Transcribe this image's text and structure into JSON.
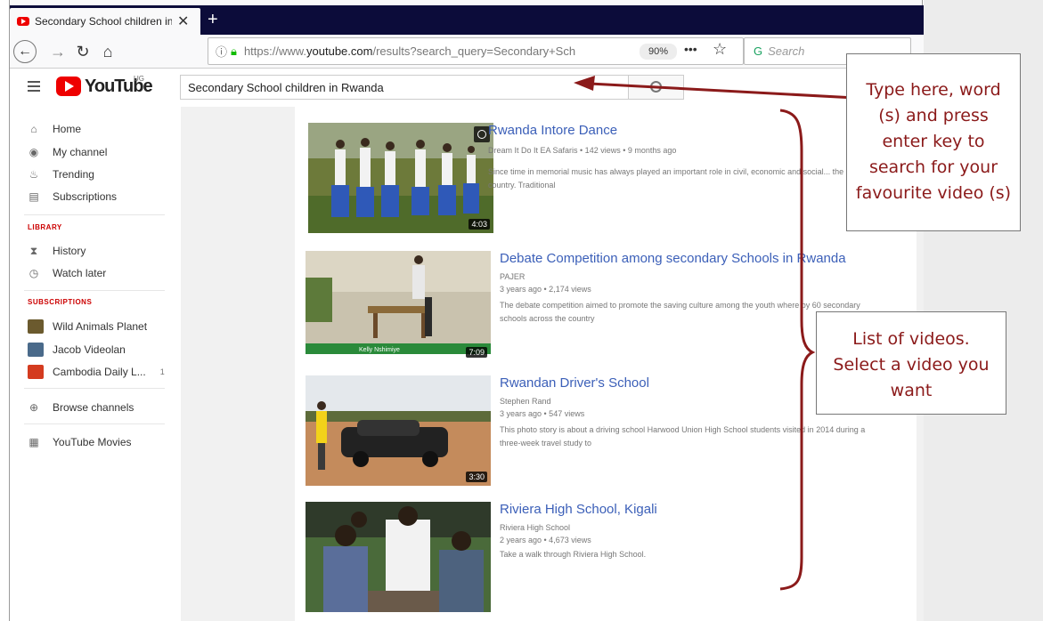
{
  "browser": {
    "tab_title": "Secondary School children in R",
    "tab_close": "✕",
    "new_tab": "+",
    "url_prefix": "https://www.",
    "url_domain": "youtube.com",
    "url_rest": "/results?search_query=Secondary+Sch",
    "zoom": "90%",
    "menu_dots": "•••",
    "search_placeholder": "Search"
  },
  "youtube": {
    "logo_text": "YouTube",
    "country": "UG",
    "search_value": "Secondary School children in Rwanda"
  },
  "sidebar": {
    "main": [
      {
        "label": "Home",
        "icon": "⌂"
      },
      {
        "label": "My channel",
        "icon": "◉"
      },
      {
        "label": "Trending",
        "icon": "♨"
      },
      {
        "label": "Subscriptions",
        "icon": "▤"
      }
    ],
    "library_heading": "LIBRARY",
    "library": [
      {
        "label": "History",
        "icon": "⧗"
      },
      {
        "label": "Watch later",
        "icon": "◷"
      }
    ],
    "subscriptions_heading": "SUBSCRIPTIONS",
    "subscriptions": [
      {
        "label": "Wild Animals Planet",
        "count": "",
        "color": "#6b5a2e"
      },
      {
        "label": "Jacob Videolan",
        "count": "",
        "color": "#4a6a8a"
      },
      {
        "label": "Cambodia Daily L...",
        "count": "1",
        "color": "#d43b1f"
      }
    ],
    "browse_channels": "Browse channels",
    "movies": "YouTube Movies"
  },
  "videos": [
    {
      "title": "Rwanda Intore Dance",
      "meta": "Dream It Do It EA Safaris • 142 views • 9 months ago",
      "desc": "Since time in memorial music has always played an important role in civil, economic and social... the country. Traditional",
      "duration": "4:03"
    },
    {
      "title": "Debate Competition among secondary Schools in Rwanda",
      "channel": "PAJER",
      "meta": "3 years ago • 2,174 views",
      "desc": "The debate competition aimed to promote the saving culture among the youth where by 60 secondary schools across the country",
      "duration": "7:09",
      "banner": "Kelly Nshimiye"
    },
    {
      "title": "Rwandan Driver's School",
      "channel": "Stephen Rand",
      "meta": "3 years ago • 547 views",
      "desc": "This photo story is about a driving school Harwood Union High School students visited in 2014 during a three-week travel study to",
      "duration": "3:30"
    },
    {
      "title": "Riviera High School, Kigali",
      "channel": "Riviera High School",
      "meta": "2 years ago • 4,673 views",
      "desc": "Take a walk through Riviera High School."
    }
  ],
  "callouts": {
    "search_lines": [
      "Type here, word",
      "(s) and press",
      "enter key to",
      "search for your",
      "favourite video (s)"
    ],
    "list_lines": [
      "List of videos.",
      "Select a video you",
      "want"
    ],
    "color": "#8b1a1a"
  }
}
